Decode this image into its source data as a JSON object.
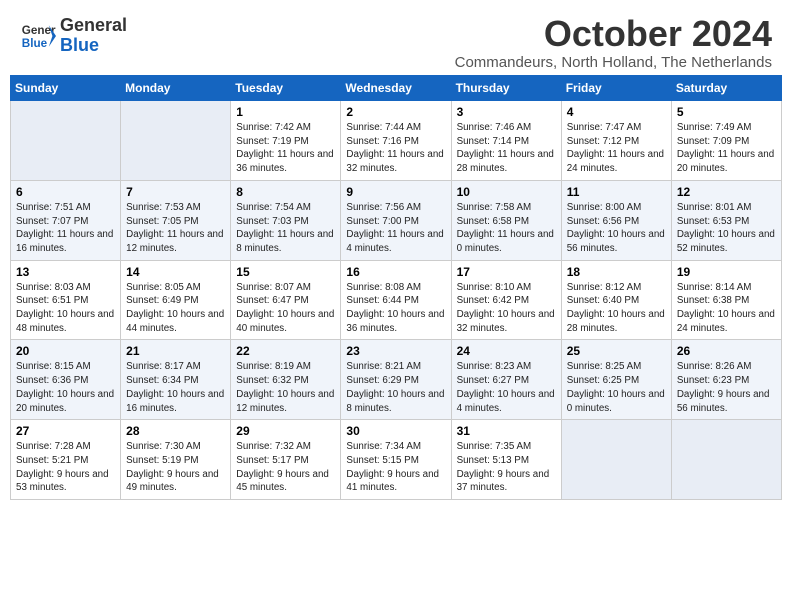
{
  "logo": {
    "line1": "General",
    "line2": "Blue"
  },
  "title": "October 2024",
  "location": "Commandeurs, North Holland, The Netherlands",
  "days_header": [
    "Sunday",
    "Monday",
    "Tuesday",
    "Wednesday",
    "Thursday",
    "Friday",
    "Saturday"
  ],
  "weeks": [
    [
      {
        "num": "",
        "info": ""
      },
      {
        "num": "",
        "info": ""
      },
      {
        "num": "1",
        "info": "Sunrise: 7:42 AM\nSunset: 7:19 PM\nDaylight: 11 hours and 36 minutes."
      },
      {
        "num": "2",
        "info": "Sunrise: 7:44 AM\nSunset: 7:16 PM\nDaylight: 11 hours and 32 minutes."
      },
      {
        "num": "3",
        "info": "Sunrise: 7:46 AM\nSunset: 7:14 PM\nDaylight: 11 hours and 28 minutes."
      },
      {
        "num": "4",
        "info": "Sunrise: 7:47 AM\nSunset: 7:12 PM\nDaylight: 11 hours and 24 minutes."
      },
      {
        "num": "5",
        "info": "Sunrise: 7:49 AM\nSunset: 7:09 PM\nDaylight: 11 hours and 20 minutes."
      }
    ],
    [
      {
        "num": "6",
        "info": "Sunrise: 7:51 AM\nSunset: 7:07 PM\nDaylight: 11 hours and 16 minutes."
      },
      {
        "num": "7",
        "info": "Sunrise: 7:53 AM\nSunset: 7:05 PM\nDaylight: 11 hours and 12 minutes."
      },
      {
        "num": "8",
        "info": "Sunrise: 7:54 AM\nSunset: 7:03 PM\nDaylight: 11 hours and 8 minutes."
      },
      {
        "num": "9",
        "info": "Sunrise: 7:56 AM\nSunset: 7:00 PM\nDaylight: 11 hours and 4 minutes."
      },
      {
        "num": "10",
        "info": "Sunrise: 7:58 AM\nSunset: 6:58 PM\nDaylight: 11 hours and 0 minutes."
      },
      {
        "num": "11",
        "info": "Sunrise: 8:00 AM\nSunset: 6:56 PM\nDaylight: 10 hours and 56 minutes."
      },
      {
        "num": "12",
        "info": "Sunrise: 8:01 AM\nSunset: 6:53 PM\nDaylight: 10 hours and 52 minutes."
      }
    ],
    [
      {
        "num": "13",
        "info": "Sunrise: 8:03 AM\nSunset: 6:51 PM\nDaylight: 10 hours and 48 minutes."
      },
      {
        "num": "14",
        "info": "Sunrise: 8:05 AM\nSunset: 6:49 PM\nDaylight: 10 hours and 44 minutes."
      },
      {
        "num": "15",
        "info": "Sunrise: 8:07 AM\nSunset: 6:47 PM\nDaylight: 10 hours and 40 minutes."
      },
      {
        "num": "16",
        "info": "Sunrise: 8:08 AM\nSunset: 6:44 PM\nDaylight: 10 hours and 36 minutes."
      },
      {
        "num": "17",
        "info": "Sunrise: 8:10 AM\nSunset: 6:42 PM\nDaylight: 10 hours and 32 minutes."
      },
      {
        "num": "18",
        "info": "Sunrise: 8:12 AM\nSunset: 6:40 PM\nDaylight: 10 hours and 28 minutes."
      },
      {
        "num": "19",
        "info": "Sunrise: 8:14 AM\nSunset: 6:38 PM\nDaylight: 10 hours and 24 minutes."
      }
    ],
    [
      {
        "num": "20",
        "info": "Sunrise: 8:15 AM\nSunset: 6:36 PM\nDaylight: 10 hours and 20 minutes."
      },
      {
        "num": "21",
        "info": "Sunrise: 8:17 AM\nSunset: 6:34 PM\nDaylight: 10 hours and 16 minutes."
      },
      {
        "num": "22",
        "info": "Sunrise: 8:19 AM\nSunset: 6:32 PM\nDaylight: 10 hours and 12 minutes."
      },
      {
        "num": "23",
        "info": "Sunrise: 8:21 AM\nSunset: 6:29 PM\nDaylight: 10 hours and 8 minutes."
      },
      {
        "num": "24",
        "info": "Sunrise: 8:23 AM\nSunset: 6:27 PM\nDaylight: 10 hours and 4 minutes."
      },
      {
        "num": "25",
        "info": "Sunrise: 8:25 AM\nSunset: 6:25 PM\nDaylight: 10 hours and 0 minutes."
      },
      {
        "num": "26",
        "info": "Sunrise: 8:26 AM\nSunset: 6:23 PM\nDaylight: 9 hours and 56 minutes."
      }
    ],
    [
      {
        "num": "27",
        "info": "Sunrise: 7:28 AM\nSunset: 5:21 PM\nDaylight: 9 hours and 53 minutes."
      },
      {
        "num": "28",
        "info": "Sunrise: 7:30 AM\nSunset: 5:19 PM\nDaylight: 9 hours and 49 minutes."
      },
      {
        "num": "29",
        "info": "Sunrise: 7:32 AM\nSunset: 5:17 PM\nDaylight: 9 hours and 45 minutes."
      },
      {
        "num": "30",
        "info": "Sunrise: 7:34 AM\nSunset: 5:15 PM\nDaylight: 9 hours and 41 minutes."
      },
      {
        "num": "31",
        "info": "Sunrise: 7:35 AM\nSunset: 5:13 PM\nDaylight: 9 hours and 37 minutes."
      },
      {
        "num": "",
        "info": ""
      },
      {
        "num": "",
        "info": ""
      }
    ]
  ]
}
